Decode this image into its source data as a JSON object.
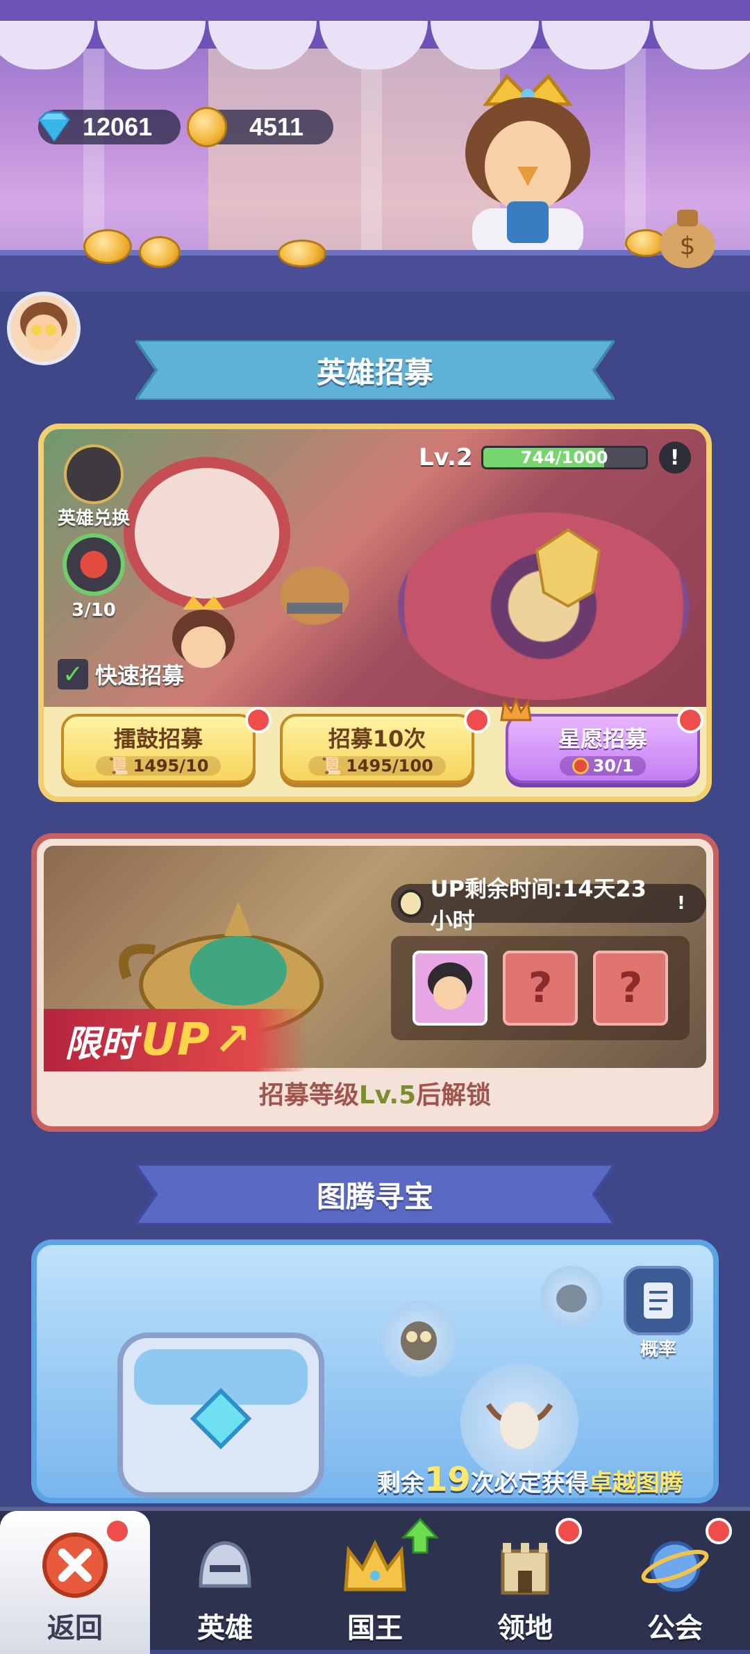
{
  "currency": {
    "gems": {
      "icon": "diamond-icon",
      "value": "12061"
    },
    "coins": {
      "icon": "gold-coin-icon",
      "value": "4511"
    }
  },
  "banners": {
    "hero_recruit": "英雄招募",
    "totem_treasure": "图腾寻宝"
  },
  "recruit": {
    "level_label": "Lv.2",
    "progress_text": "744/1000",
    "progress_fraction": 0.744,
    "info_symbol": "!",
    "hero_exchange_label": "英雄兑换",
    "draw_counter": "3/10",
    "quick_recruit_label": "快速招募",
    "buttons": [
      {
        "name": "擂鼓招募",
        "cost": "1495/10",
        "cost_icon": "scroll-icon",
        "badge": true
      },
      {
        "name": "招募10次",
        "cost": "1495/100",
        "cost_icon": "scroll-icon",
        "badge": true
      },
      {
        "name": "星愿招募",
        "cost": "30/1",
        "cost_icon": "star-coin-icon",
        "badge": true
      }
    ]
  },
  "up_event": {
    "timer_text": "UP剩余时间:14天23小时",
    "info_symbol": "!",
    "tag_prefix": "限时",
    "tag_main": "UP",
    "slots": [
      "hero",
      "?",
      "?"
    ],
    "unlock_prefix": "招募等级",
    "unlock_level": "Lv.5",
    "unlock_suffix": "后解锁"
  },
  "treasure": {
    "probability_label": "概率",
    "remain_prefix": "剩余",
    "remain_count": "19",
    "remain_middle": "次必定获得",
    "remain_highlight": "卓越图腾"
  },
  "nav": [
    {
      "label": "返回",
      "icon": "close-icon",
      "active": true,
      "badge": "dot"
    },
    {
      "label": "英雄",
      "icon": "helmet-icon",
      "active": false,
      "badge": ""
    },
    {
      "label": "国王",
      "icon": "crown-icon",
      "active": false,
      "badge": "arrow"
    },
    {
      "label": "领地",
      "icon": "castle-icon",
      "active": false,
      "badge": "dot"
    },
    {
      "label": "公会",
      "icon": "planet-icon",
      "active": false,
      "badge": "dot"
    }
  ]
}
